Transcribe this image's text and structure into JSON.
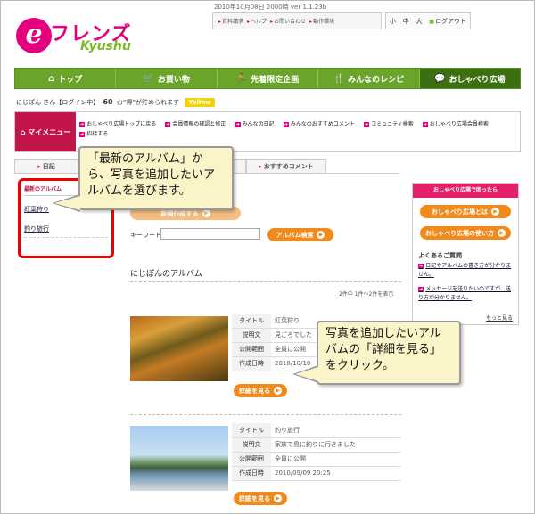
{
  "header": {
    "date": "2010年10月08日 2000時 ver 1.1.23b",
    "logo": {
      "e": "e",
      "friends": "フレンズ",
      "kyushu": "Kyushu"
    },
    "util_links": [
      "資料請求",
      "ヘルプ",
      "お問い合わせ",
      "動作環境"
    ],
    "font_size": [
      "小",
      "中",
      "大"
    ],
    "logout": "ログアウト"
  },
  "nav": [
    {
      "icon": "house",
      "label": "トップ"
    },
    {
      "icon": "cart",
      "label": "お買い物"
    },
    {
      "icon": "runner",
      "label": "先着限定企画"
    },
    {
      "icon": "fork",
      "label": "みんなのレシピ"
    },
    {
      "icon": "speech",
      "label": "おしゃべり広場"
    }
  ],
  "user": {
    "name": "にじぽん",
    "suffix": "さん【ログイン中】",
    "points": "60",
    "points_note": "お“得”が貯められます",
    "badge": "Yellow"
  },
  "mymenu": {
    "label": "マイメニュー",
    "links": [
      "おしゃべり広場トップに戻る",
      "会員情報の確認と修正",
      "みんなの日記",
      "みんなのおすすめコメント",
      "コミュニティ検索",
      "おしゃべり広場会員検索",
      "招待する"
    ]
  },
  "tabs": [
    "日記",
    "",
    "お気に入り",
    "おすすめコメント"
  ],
  "left_sidebar": {
    "heading": "最新のアルバム",
    "albums": [
      "紅葉狩り",
      "釣り旅行"
    ]
  },
  "callouts": {
    "one": "「最新のアルバム」から、写真を追加したいアルバムを選びます。",
    "two": "写真を追加したいアルバムの「詳細を見る」をクリック。"
  },
  "main": {
    "hidden_button": "新規作成する",
    "keyword_label": "キーワード",
    "keyword_value": "",
    "search_button": "アルバム検索",
    "section_title": "にじぽんのアルバム",
    "count": "2件中 1件～2件を表示",
    "albums": [
      {
        "title_k": "タイトル",
        "title": "紅葉狩り",
        "desc_k": "説明文",
        "desc": "見ごろでした",
        "pub_k": "公開範囲",
        "pub": "全員に公開",
        "date_k": "作成日時",
        "date": "2010/10/10",
        "detail": "詳細を見る"
      },
      {
        "title_k": "タイトル",
        "title": "釣り旅行",
        "desc_k": "説明文",
        "desc": "家族で島に釣りに行きました",
        "pub_k": "公開範囲",
        "pub": "全員に公開",
        "date_k": "作成日時",
        "date": "2010/09/09 20:25",
        "detail": "詳細を見る"
      }
    ]
  },
  "right_sidebar": {
    "heading": "おしゃべり広場で困ったら",
    "btn1": "おしゃべり広場とは",
    "btn2": "おしゃべり広場の使い方",
    "faq_title": "よくあるご質問",
    "q1": "日記やアルバムの書き方が分かりません。",
    "q2": "メッセージを送りたいのですが、送り方が分かりません。",
    "more": "もっと見る"
  },
  "colors": {
    "accent": "#e4007f",
    "nav_green": "#6aa42a",
    "button_orange": "#f08a1c",
    "callout_bg": "#fbf4c8",
    "highlight": "#ee0000"
  }
}
